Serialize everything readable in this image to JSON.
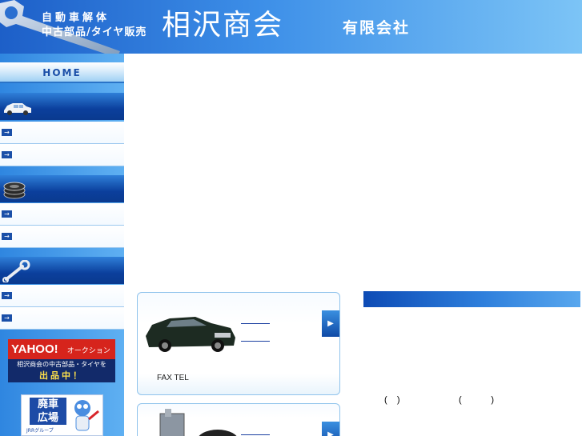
{
  "header": {
    "subtitle_line1": "自動車解体",
    "subtitle_line2": "中古部品/タイヤ販売",
    "company_name": "相沢商会",
    "company_type": "有限会社"
  },
  "sidebar": {
    "home_label": "HOME",
    "sections": [
      {
        "icon": "car-icon",
        "links": [
          "",
          ""
        ]
      },
      {
        "icon": "tire-icon",
        "links": [
          "",
          ""
        ]
      },
      {
        "icon": "wrench-icon",
        "links": [
          "",
          ""
        ]
      }
    ],
    "yahoo_banner": {
      "logo": "YAHOO!",
      "service": "オークション",
      "line1": "相沢商会の中古部品・タイヤを",
      "line2": "出品中！"
    },
    "haisha_banner": {
      "title_line1": "廃車",
      "title_line2": "広場",
      "caption": "JRRグループ"
    }
  },
  "main": {
    "card1": {
      "footer_text": "FAX TEL"
    },
    "right_text": {
      "paren_left": "(    )",
      "paren_right": "(            )"
    }
  },
  "colors": {
    "header_blue": "#1d5fc8",
    "section_navy": "#0b3f9c",
    "yahoo_red": "#d6241c",
    "banner_navy": "#122a6a"
  }
}
